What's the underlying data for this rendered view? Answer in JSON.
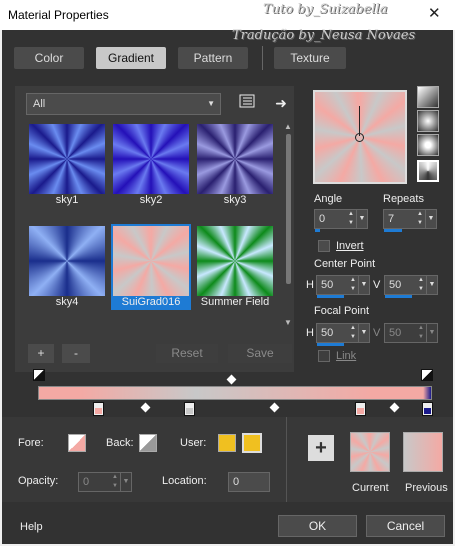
{
  "window": {
    "title": "Material Properties",
    "close_glyph": "✕"
  },
  "watermark": {
    "line1": "Tuto by_Suizabella",
    "line2": "Tradução by_Neusa Novaes"
  },
  "tabs": [
    "Color",
    "Gradient",
    "Pattern",
    "Texture"
  ],
  "active_tab": "Gradient",
  "filter": {
    "selected": "All"
  },
  "gradients": [
    {
      "label": "sky1"
    },
    {
      "label": "sky2"
    },
    {
      "label": "sky3"
    },
    {
      "label": "sky4"
    },
    {
      "label": "SuiGrad016",
      "selected": true
    },
    {
      "label": "Summer Field"
    }
  ],
  "list_buttons": {
    "add": "+",
    "remove": "-",
    "reset": "Reset",
    "save": "Save"
  },
  "angle": {
    "label": "Angle",
    "value": "0"
  },
  "repeats": {
    "label": "Repeats",
    "value": "7"
  },
  "invert": {
    "label": "Invert"
  },
  "center_point": {
    "label": "Center Point",
    "h_label": "H",
    "h": "50",
    "v_label": "V",
    "v": "50"
  },
  "focal_point": {
    "label": "Focal Point",
    "h_label": "H",
    "h": "50",
    "v_label": "V",
    "v": "50"
  },
  "link": {
    "label": "Link"
  },
  "fore": {
    "label": "Fore:"
  },
  "back": {
    "label": "Back:"
  },
  "user": {
    "label": "User:"
  },
  "opacity": {
    "label": "Opacity:",
    "value": "0"
  },
  "location": {
    "label": "Location:",
    "value": "0"
  },
  "add_gradient_glyph": "+",
  "current": {
    "label": "Current"
  },
  "previous": {
    "label": "Previous"
  },
  "footer": {
    "help": "Help",
    "ok": "OK",
    "cancel": "Cancel"
  },
  "colors": {
    "accent": "#1e7bd4",
    "pink": "#f4a9a4",
    "grey": "#c8c8c8",
    "user_yellow": "#f0c020",
    "stop_navy": "#1a1a8c"
  }
}
